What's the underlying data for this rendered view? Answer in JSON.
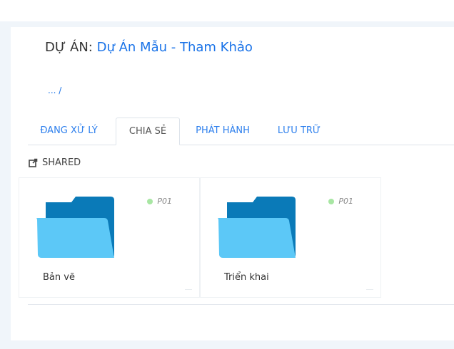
{
  "project": {
    "prefix": "DỰ ÁN:",
    "name": "Dự Án Mẫu - Tham Khảo"
  },
  "breadcrumb": "... /",
  "tabs": [
    {
      "label": "ĐANG XỬ LÝ",
      "active": false
    },
    {
      "label": "CHIA SẺ",
      "active": true
    },
    {
      "label": "PHÁT HÀNH",
      "active": false
    },
    {
      "label": "LƯU TRỮ",
      "active": false
    }
  ],
  "section": {
    "icon": "share-icon",
    "label": "SHARED"
  },
  "folders": [
    {
      "name": "Bản vẽ",
      "code": "P01",
      "icon": "folder-icon"
    },
    {
      "name": "Triển khai",
      "code": "P01",
      "icon": "folder-icon"
    }
  ],
  "colors": {
    "accent": "#1a73e8",
    "tab_text": "#2f80ed",
    "folder_back": "#0a7ab8",
    "folder_front": "#5cc8f7",
    "status_dot": "#a8e6a3"
  }
}
